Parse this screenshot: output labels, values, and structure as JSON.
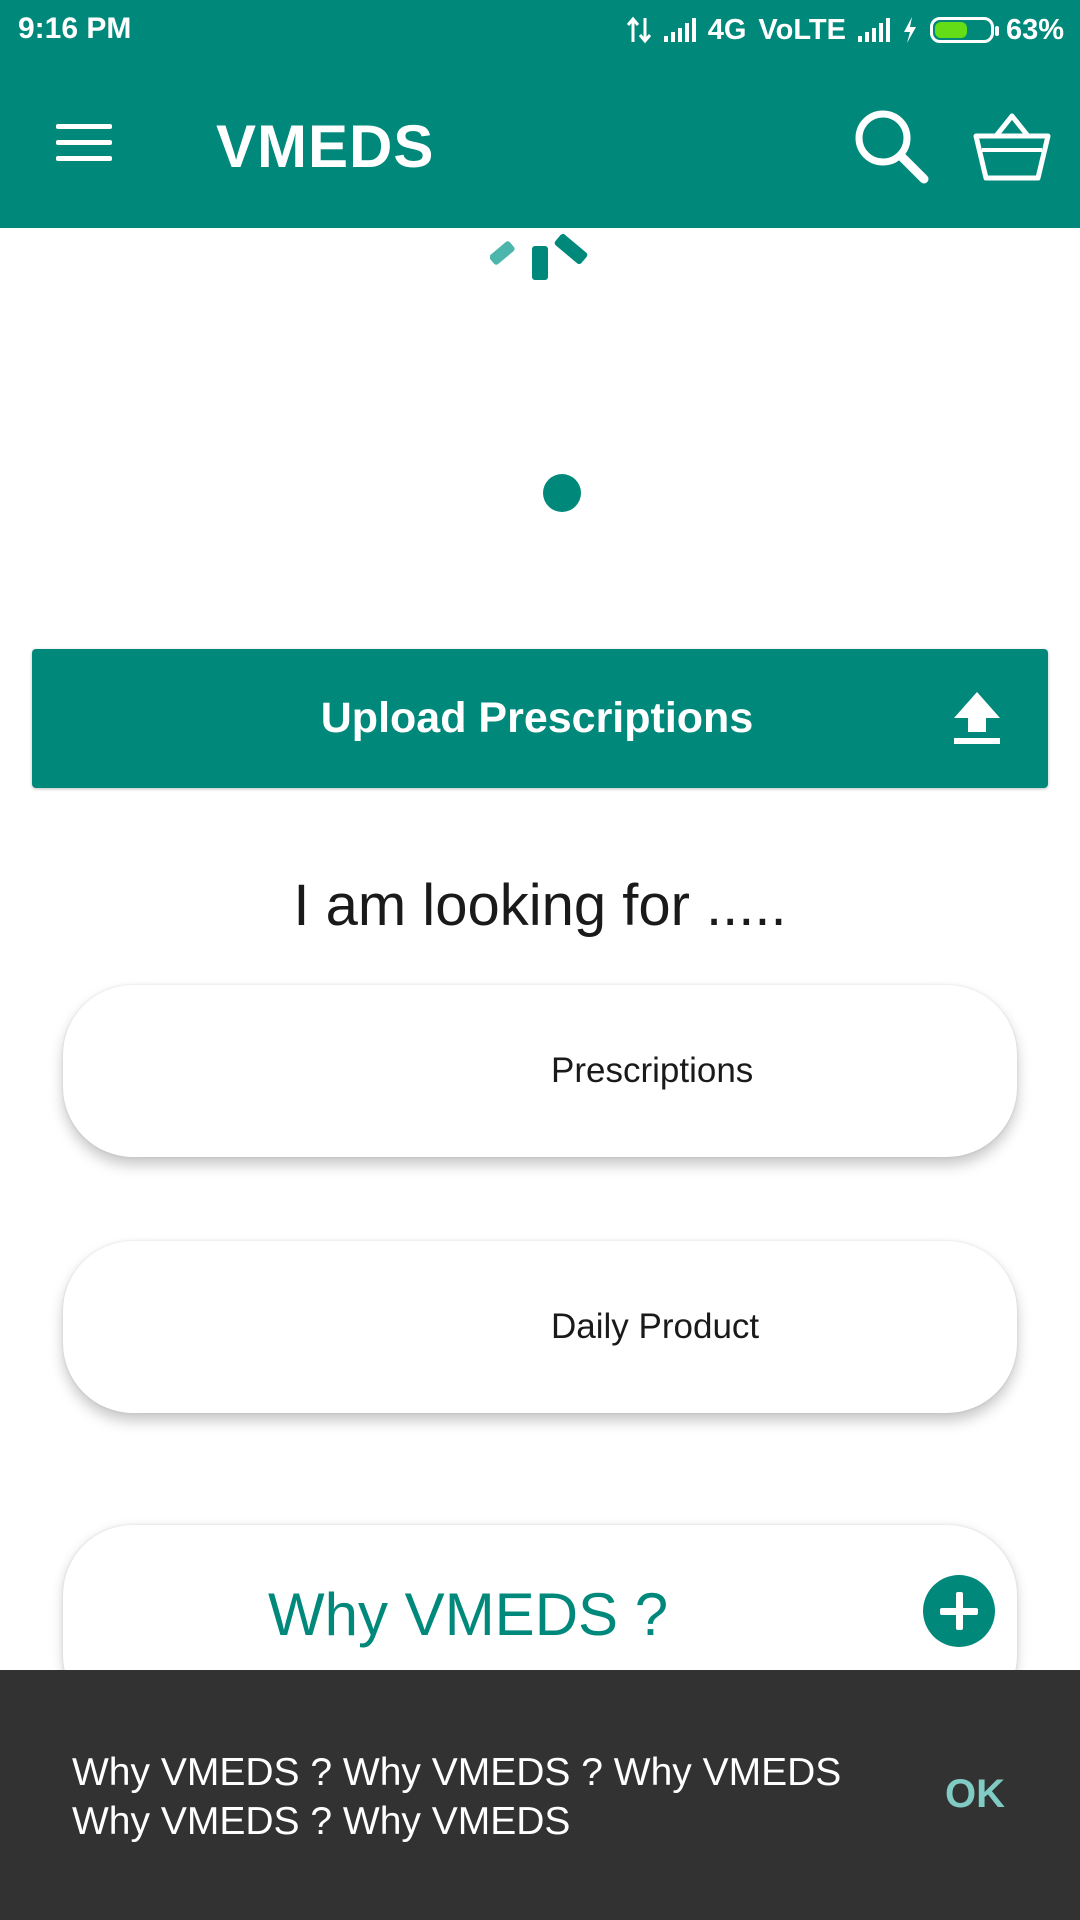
{
  "status_bar": {
    "time": "9:16 PM",
    "network": "4G",
    "volte": "VoLTE",
    "battery_percent": "63%",
    "battery_level": 0.63
  },
  "app_bar": {
    "title": "VMEDS",
    "icons": [
      "menu-icon",
      "search-icon",
      "basket-icon"
    ],
    "color": "#00897B"
  },
  "upload": {
    "label": "Upload Prescriptions",
    "icon": "upload-icon"
  },
  "looking_for": {
    "heading": "I am looking for .....",
    "options": [
      {
        "label": "Prescriptions"
      },
      {
        "label": "Daily Product"
      }
    ]
  },
  "why": {
    "title": "Why VMEDS ?",
    "icon": "plus-icon"
  },
  "snackbar": {
    "line1": "Why VMEDS ? Why VMEDS ? Why VMEDS",
    "line2": "Why VMEDS ? Why VMEDS",
    "action": "OK",
    "action_color": "#80CBC4"
  }
}
